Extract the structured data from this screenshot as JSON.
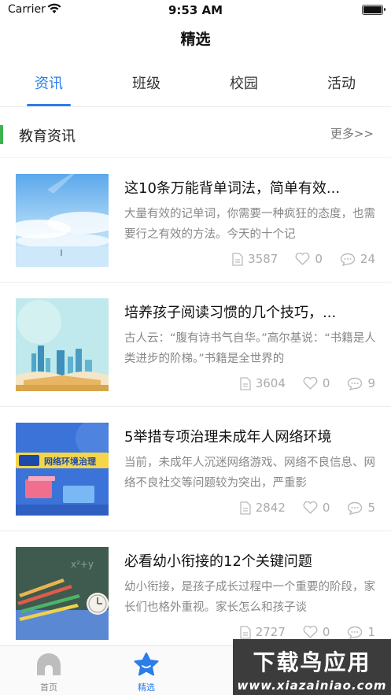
{
  "status_bar": {
    "carrier": "Carrier",
    "time": "9:53 AM"
  },
  "nav": {
    "title": "精选"
  },
  "tabs": [
    {
      "label": "资讯",
      "active": true
    },
    {
      "label": "班级",
      "active": false
    },
    {
      "label": "校园",
      "active": false
    },
    {
      "label": "活动",
      "active": false
    }
  ],
  "section": {
    "title": "教育资讯",
    "more": "更多>>"
  },
  "news": [
    {
      "title": "这10条万能背单词法，简单有效...",
      "desc": "大量有效的记单词，你需要一种疯狂的态度，也需要行之有效的方法。今天的十个记",
      "views": "3587",
      "likes": "0",
      "comments": "24",
      "thumb": "sky-clouds"
    },
    {
      "title": "培养孩子阅读习惯的几个技巧，...",
      "desc": "古人云：“腹有诗书气自华。”高尔基说：“书籍是人类进步的阶梯。”书籍是全世界的",
      "views": "3604",
      "likes": "0",
      "comments": "9",
      "thumb": "city-books"
    },
    {
      "title": "5举措专项治理未成年人网络环境",
      "desc": "当前，未成年人沉迷网络游戏、网络不良信息、网络不良社交等问题较为突出，严重影",
      "views": "2842",
      "likes": "0",
      "comments": "5",
      "thumb": "network",
      "thumb_text": "网络环境治理"
    },
    {
      "title": "必看幼小衔接的12个关键问题",
      "desc": "幼小衔接，是孩子成长过程中一个重要的阶段，家长们也格外重视。家长怎么和孩子谈",
      "views": "2727",
      "likes": "0",
      "comments": "1",
      "thumb": "pencils-clock"
    }
  ],
  "tabbar": [
    {
      "label": "首页",
      "icon": "home-icon",
      "active": false
    },
    {
      "label": "精选",
      "icon": "star-icon",
      "active": true
    }
  ],
  "watermark": {
    "main": "下载鸟应用",
    "sub": "www.xiazainiao.com"
  },
  "colors": {
    "accent": "#2b7de9",
    "section_bar": "#3cb44b",
    "muted": "#aaaaaa"
  }
}
